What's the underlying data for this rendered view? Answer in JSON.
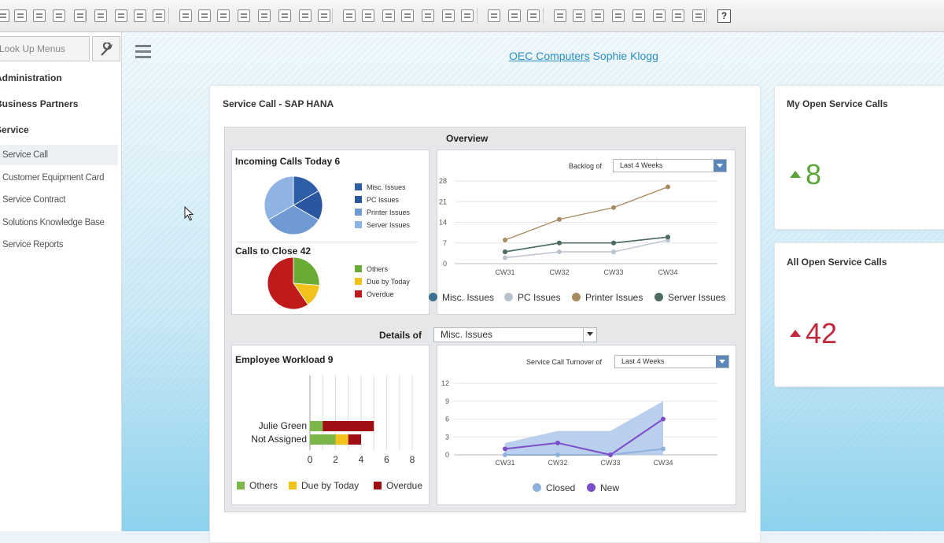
{
  "toolbar": {
    "help_label": "?"
  },
  "sidebar": {
    "lookup_placeholder": "Look Up Menus",
    "categories": [
      "Administration",
      "Business Partners",
      "Service"
    ],
    "items": [
      "Service Call",
      "Customer Equipment Card",
      "Service Contract",
      "Solutions Knowledge Base",
      "Service Reports"
    ],
    "active_item": "Service Call"
  },
  "header": {
    "company": "OEC Computers",
    "user": "Sophie Klogg"
  },
  "main_card": {
    "title": "Service Call - SAP HANA",
    "overview_title": "Overview",
    "incoming": {
      "title": "Incoming Calls Today 6",
      "legend": [
        "Misc. Issues",
        "PC Issues",
        "Printer Issues",
        "Server Issues"
      ],
      "colors": [
        "#2e5fa6",
        "#2a56a0",
        "#6f9ad3",
        "#8fb4e3"
      ]
    },
    "to_close": {
      "title": "Calls to Close 42",
      "legend": [
        "Others",
        "Due by Today",
        "Overdue"
      ],
      "colors": [
        "#6aab35",
        "#f2c21b",
        "#c01b1b"
      ]
    },
    "backlog": {
      "label": "Backlog of",
      "selected": "Last 4 Weeks"
    },
    "details": {
      "label": "Details of",
      "selected": "Misc. Issues"
    },
    "workload": {
      "title": "Employee Workload 9"
    },
    "turnover": {
      "label": "Service Call Turnover of",
      "selected": "Last 4 Weeks"
    }
  },
  "kpi": {
    "my_open": {
      "title": "My Open Service Calls",
      "value": "8",
      "color": "#5aa43a"
    },
    "all_open": {
      "title": "All Open Service Calls",
      "value": "42",
      "color": "#c0283c"
    }
  },
  "chart_data": [
    {
      "type": "pie",
      "title": "Incoming Calls Today 6",
      "categories": [
        "Misc. Issues",
        "PC Issues",
        "Printer Issues",
        "Server Issues"
      ],
      "values": [
        1,
        1,
        2,
        2
      ]
    },
    {
      "type": "pie",
      "title": "Calls to Close 42",
      "categories": [
        "Others",
        "Due by Today",
        "Overdue"
      ],
      "values": [
        11,
        6,
        25
      ]
    },
    {
      "type": "line",
      "categories": [
        "CW31",
        "CW32",
        "CW33",
        "CW34"
      ],
      "ylim": [
        0,
        28
      ],
      "yticks": [
        0,
        7,
        14,
        21,
        28
      ],
      "series": [
        {
          "name": "Misc. Issues",
          "values": [
            4,
            7,
            7,
            9
          ],
          "color": "#3f6f93"
        },
        {
          "name": "PC Issues",
          "values": [
            2,
            4,
            4,
            8
          ],
          "color": "#b9c2cd"
        },
        {
          "name": "Printer Issues",
          "values": [
            8,
            15,
            19,
            26
          ],
          "color": "#a88a60"
        },
        {
          "name": "Server Issues",
          "values": [
            4,
            7,
            7,
            9
          ],
          "color": "#4e6b63"
        }
      ],
      "legend": "bottom"
    },
    {
      "type": "bar",
      "orientation": "horizontal",
      "stacked": true,
      "categories": [
        "Julie Green",
        "Not Assigned"
      ],
      "xlim": [
        0,
        8
      ],
      "xticks": [
        0,
        2,
        4,
        6,
        8
      ],
      "series": [
        {
          "name": "Others",
          "values": [
            1,
            2
          ],
          "color": "#7ab648"
        },
        {
          "name": "Due by Today",
          "values": [
            0,
            1
          ],
          "color": "#f2c21b"
        },
        {
          "name": "Overdue",
          "values": [
            4,
            1
          ],
          "color": "#9e0e12"
        }
      ],
      "legend": "bottom"
    },
    {
      "type": "area",
      "categories": [
        "CW31",
        "CW32",
        "CW33",
        "CW34"
      ],
      "ylim": [
        0,
        12
      ],
      "yticks": [
        0,
        3,
        6,
        9,
        12
      ],
      "series": [
        {
          "name": "Closed",
          "values": [
            0,
            0,
            0,
            1
          ],
          "color": "#8fb0db"
        },
        {
          "name": "New",
          "values": [
            1,
            2,
            0,
            6
          ],
          "color": "#7c4fc7"
        }
      ],
      "band": {
        "name": "range",
        "upper": [
          2,
          4,
          4,
          9
        ],
        "lower": [
          0,
          0,
          0,
          0
        ]
      },
      "legend": "bottom"
    }
  ]
}
